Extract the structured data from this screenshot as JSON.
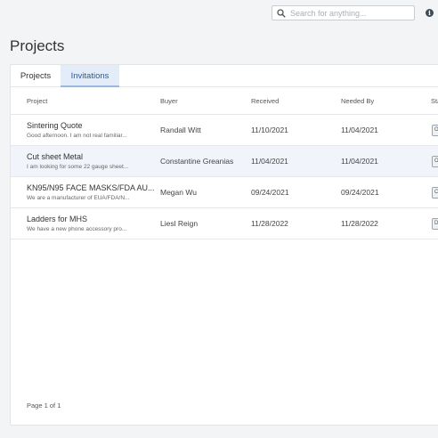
{
  "search": {
    "placeholder": "Search for anything..."
  },
  "info_icon": {
    "glyph": "i"
  },
  "page": {
    "title": "Projects"
  },
  "tabs": [
    {
      "label": "Projects",
      "active": false
    },
    {
      "label": "Invitations",
      "active": true
    }
  ],
  "table": {
    "headers": {
      "project": "Project",
      "buyer": "Buyer",
      "received": "Received",
      "needed_by": "Needed By",
      "status": "Sta"
    },
    "rows": [
      {
        "title": "Sintering Quote",
        "desc": "Good afternoon. I am not real familiar...",
        "buyer": "Randall Witt",
        "received": "11/10/2021",
        "needed_by": "11/04/2021",
        "status": "O"
      },
      {
        "title": "Cut sheet Metal",
        "desc": "I am looking for some 22 gauge sheet...",
        "buyer": "Constantine Greanias",
        "received": "11/04/2021",
        "needed_by": "11/04/2021",
        "status": "O"
      },
      {
        "title": "KN95/N95 FACE MASKS/FDA AU...",
        "desc": "We are a manufacturer of EUA/FDA/N...",
        "buyer": "Megan Wu",
        "received": "09/24/2021",
        "needed_by": "09/24/2021",
        "status": "C"
      },
      {
        "title": "Ladders for MHS",
        "desc": "We have a new phone accessory pro...",
        "buyer": "Liesl Reign",
        "received": "11/28/2022",
        "needed_by": "11/28/2022",
        "status": "D"
      }
    ]
  },
  "footer": {
    "pagination": "Page 1 of 1"
  },
  "colors": {
    "accent": "#2a5aa0",
    "active_tab_bg": "#e3edf9",
    "row_highlight": "#f1f5fb"
  }
}
